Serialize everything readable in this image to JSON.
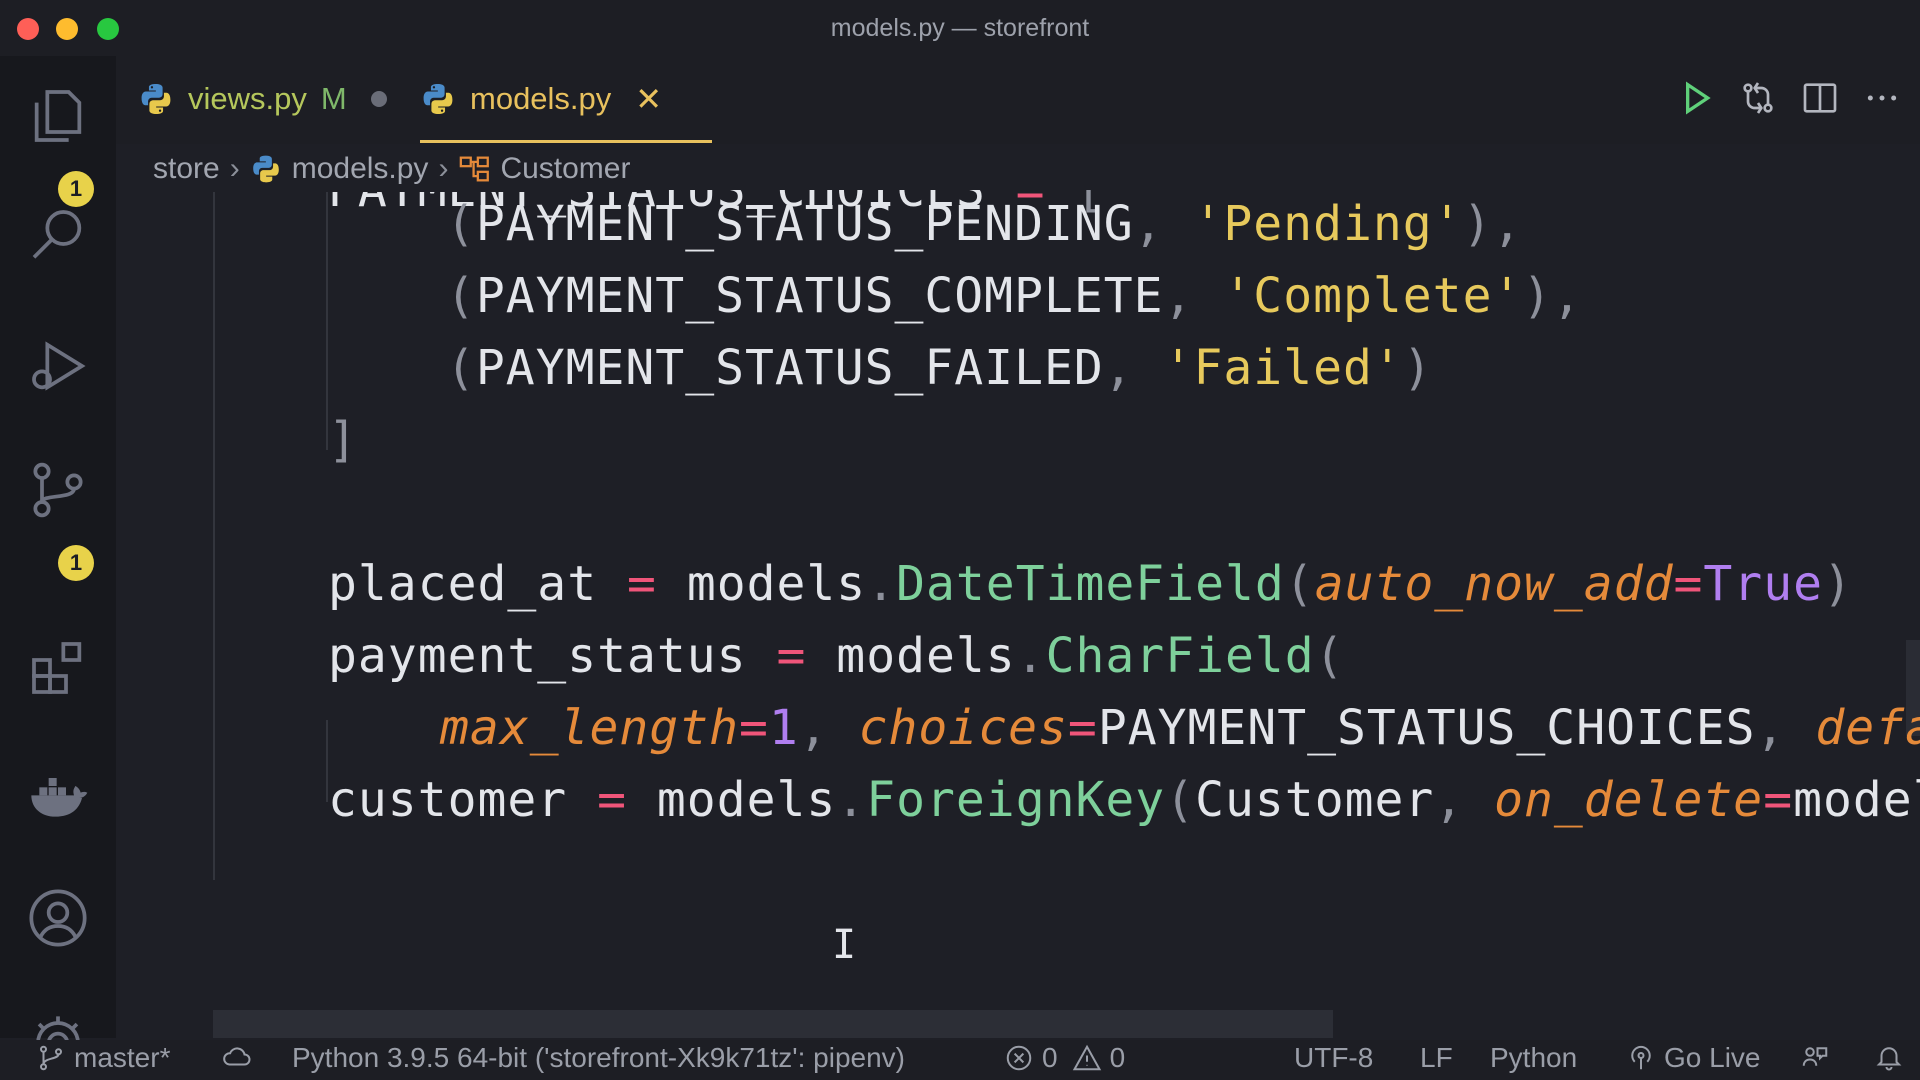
{
  "window": {
    "title": "models.py — storefront"
  },
  "activity_bar": {
    "explorer_badge": "1",
    "source_control_badge": "1"
  },
  "tabs": [
    {
      "label": "views.py",
      "status": "M"
    },
    {
      "label": "models.py"
    }
  ],
  "breadcrumb": {
    "folder": "store",
    "file": "models.py",
    "symbol": "Customer"
  },
  "code": {
    "line0": {
      "name": "PAYMENT_STATUS_CHOICES",
      "op": "=",
      "open": "["
    },
    "line1": {
      "open": "(",
      "const": "PAYMENT_STATUS_PENDING",
      "comma": ",",
      "str": "'Pending'",
      "close": "),"
    },
    "line2": {
      "open": "(",
      "const": "PAYMENT_STATUS_COMPLETE",
      "comma": ",",
      "str": "'Complete'",
      "close": "),"
    },
    "line3": {
      "open": "(",
      "const": "PAYMENT_STATUS_FAILED",
      "comma": ",",
      "str": "'Failed'",
      "close": ")"
    },
    "line4": {
      "close": "]"
    },
    "line5": {
      "name": "placed_at",
      "op": "=",
      "obj": "models",
      "dot": ".",
      "fn": "DateTimeField",
      "open": "(",
      "kw": "auto_now_add",
      "eq": "=",
      "val": "True",
      "close": ")"
    },
    "line6": {
      "name": "payment_status",
      "op": "=",
      "obj": "models",
      "dot": ".",
      "fn": "CharField",
      "open": "("
    },
    "line7": {
      "kw1": "max_length",
      "eq1": "=",
      "num": "1",
      "comma1": ",",
      "kw2": "choices",
      "eq2": "=",
      "val": "PAYMENT_STATUS_CHOICES",
      "comma2": ",",
      "kw3": "defau"
    },
    "line8": {
      "name": "customer",
      "op": "=",
      "obj": "models",
      "dot": ".",
      "fn": "ForeignKey",
      "open": "(",
      "arg": "Customer",
      "comma": ",",
      "kw": "on_delete",
      "eq": "=",
      "rest": "models"
    }
  },
  "statusbar": {
    "branch": "master*",
    "interpreter": "Python 3.9.5 64-bit ('storefront-Xk9k71tz': pipenv)",
    "errors": "0",
    "warnings": "0",
    "encoding": "UTF-8",
    "eol": "LF",
    "language": "Python",
    "live": "Go Live"
  }
}
